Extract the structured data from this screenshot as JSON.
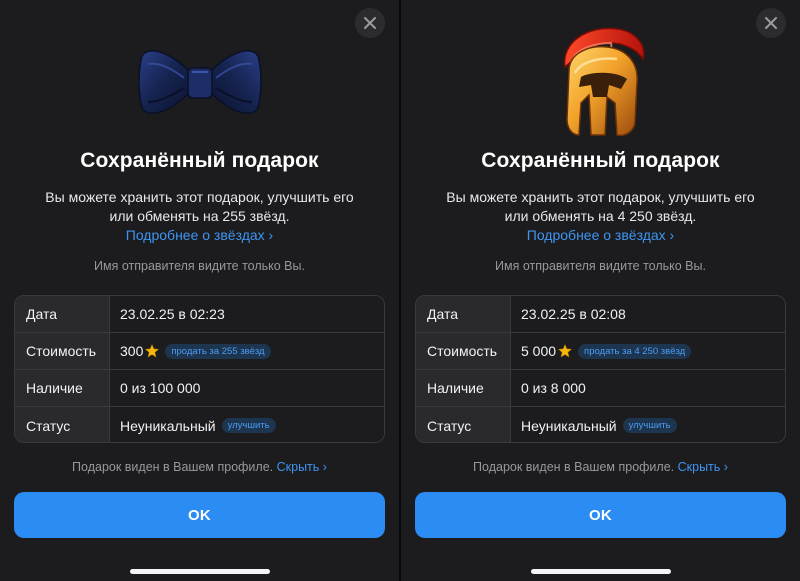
{
  "left": {
    "gift_icon": "bow-tie",
    "title": "Сохранённый подарок",
    "description_line1": "Вы можете хранить этот подарок, улучшить его",
    "description_line2": "или обменять на 255 звёзд.",
    "more_link": "Подробнее о звёздах",
    "sender_note": "Имя отправителя видите только Вы.",
    "rows": [
      {
        "label": "Дата",
        "value": "23.02.25 в 02:23"
      },
      {
        "label": "Стоимость",
        "value": "300",
        "pill": "продать за 255 звёзд"
      },
      {
        "label": "Наличие",
        "value": "0 из 100 000"
      },
      {
        "label": "Статус",
        "value": "Неуникальный",
        "pill": "улучшить"
      }
    ],
    "profile_note": "Подарок виден в Вашем профиле.",
    "hide_link": "Скрыть",
    "ok_label": "OK"
  },
  "right": {
    "gift_icon": "spartan-helmet",
    "title": "Сохранённый подарок",
    "description_line1": "Вы можете хранить этот подарок, улучшить его",
    "description_line2": "или обменять на 4 250 звёзд.",
    "more_link": "Подробнее о звёздах",
    "sender_note": "Имя отправителя видите только Вы.",
    "rows": [
      {
        "label": "Дата",
        "value": "23.02.25 в 02:08"
      },
      {
        "label": "Стоимость",
        "value": "5 000",
        "pill": "продать за 4 250 звёзд"
      },
      {
        "label": "Наличие",
        "value": "0 из 8 000"
      },
      {
        "label": "Статус",
        "value": "Неуникальный",
        "pill": "улучшить"
      }
    ],
    "profile_note": "Подарок виден в Вашем профиле.",
    "hide_link": "Скрыть",
    "ok_label": "OK"
  },
  "colors": {
    "accent": "#2b8cf3",
    "link": "#3e95f2",
    "panel_bg": "#1c1c1e",
    "star": "#f5b90d"
  }
}
